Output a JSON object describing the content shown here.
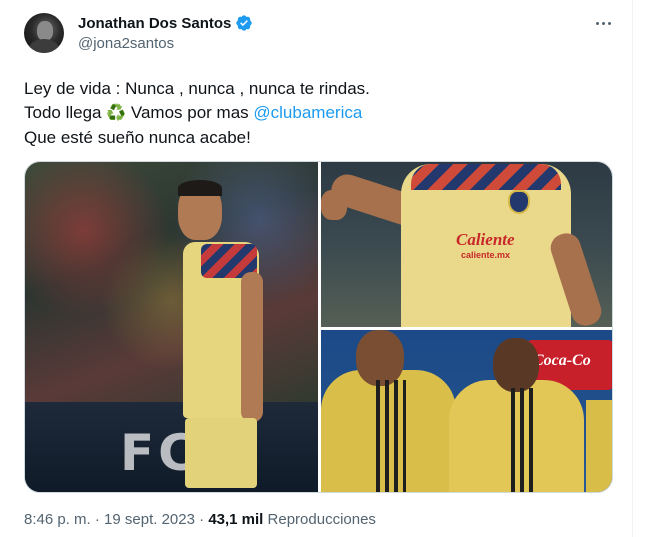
{
  "author": {
    "display_name": "Jonathan Dos Santos",
    "handle": "@jona2santos",
    "verified": true,
    "avatar_icon": "profile-photo"
  },
  "tweet": {
    "line1": "Ley de vida : Nunca , nunca , nunca te rindas.",
    "line2_before": "Todo llega ",
    "line2_emoji": "♻️",
    "line2_middle": " Vamos por mas ",
    "line2_mention": "@clubamerica",
    "line3": "Que esté sueño nunca acabe!",
    "mention_color": "#1d9bf0"
  },
  "media": {
    "photo1_board_text": "FC",
    "photo2_sponsor": "Caliente",
    "photo2_sponsor_sub": "caliente.mx",
    "photo3_sign": "Coca-Co"
  },
  "footer": {
    "time": "8:46 p. m.",
    "sep1": " · ",
    "date": "19 sept. 2023",
    "sep2": " · ",
    "views_count": "43,1 mil",
    "views_label": " Reproducciones"
  }
}
